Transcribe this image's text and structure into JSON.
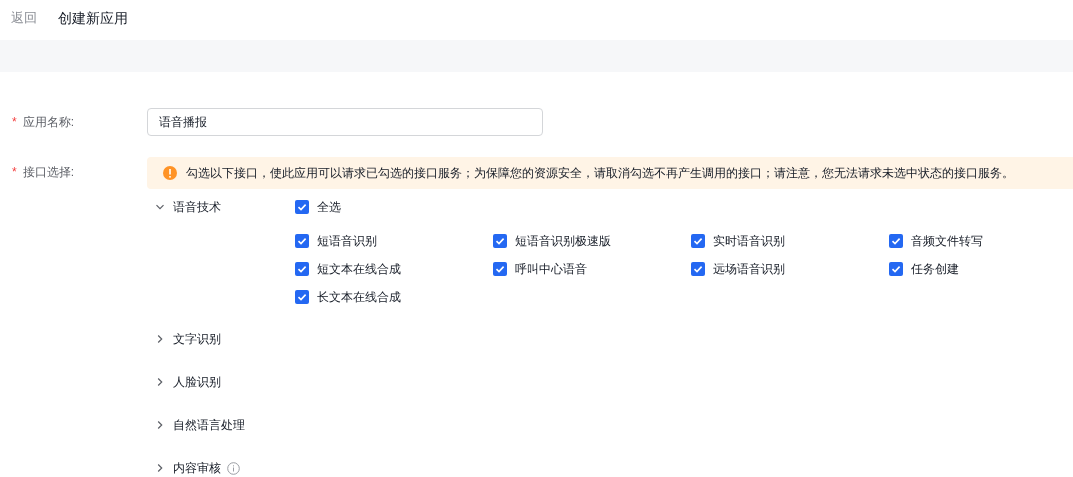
{
  "header": {
    "back": "返回",
    "title": "创建新应用"
  },
  "fields": [
    {
      "mark": "*",
      "label": "应用名称:",
      "kind": "input",
      "value": "语音播报"
    },
    {
      "mark": "*",
      "label": "接口选择:",
      "kind": "apis",
      "notice": "勾选以下接口，使此应用可以请求已勾选的接口服务；为保障您的资源安全，请取消勾选不再产生调用的接口；请注意，您无法请求未选中状态的接口服务。"
    }
  ],
  "categories": [
    {
      "name": "语音技术",
      "expanded": true,
      "info": false,
      "select_all": {
        "label": "全选",
        "checked": true
      },
      "items": [
        {
          "label": "短语音识别",
          "checked": true
        },
        {
          "label": "短语音识别极速版",
          "checked": true
        },
        {
          "label": "实时语音识别",
          "checked": true
        },
        {
          "label": "音频文件转写",
          "checked": true
        },
        {
          "label": "短文本在线合成",
          "checked": true
        },
        {
          "label": "呼叫中心语音",
          "checked": true
        },
        {
          "label": "远场语音识别",
          "checked": true
        },
        {
          "label": "任务创建",
          "checked": true
        },
        {
          "label": "长文本在线合成",
          "checked": true
        }
      ]
    },
    {
      "name": "文字识别",
      "expanded": false,
      "info": false
    },
    {
      "name": "人脸识别",
      "expanded": false,
      "info": false
    },
    {
      "name": "自然语言处理",
      "expanded": false,
      "info": false
    },
    {
      "name": "内容审核",
      "expanded": false,
      "info": true
    }
  ]
}
